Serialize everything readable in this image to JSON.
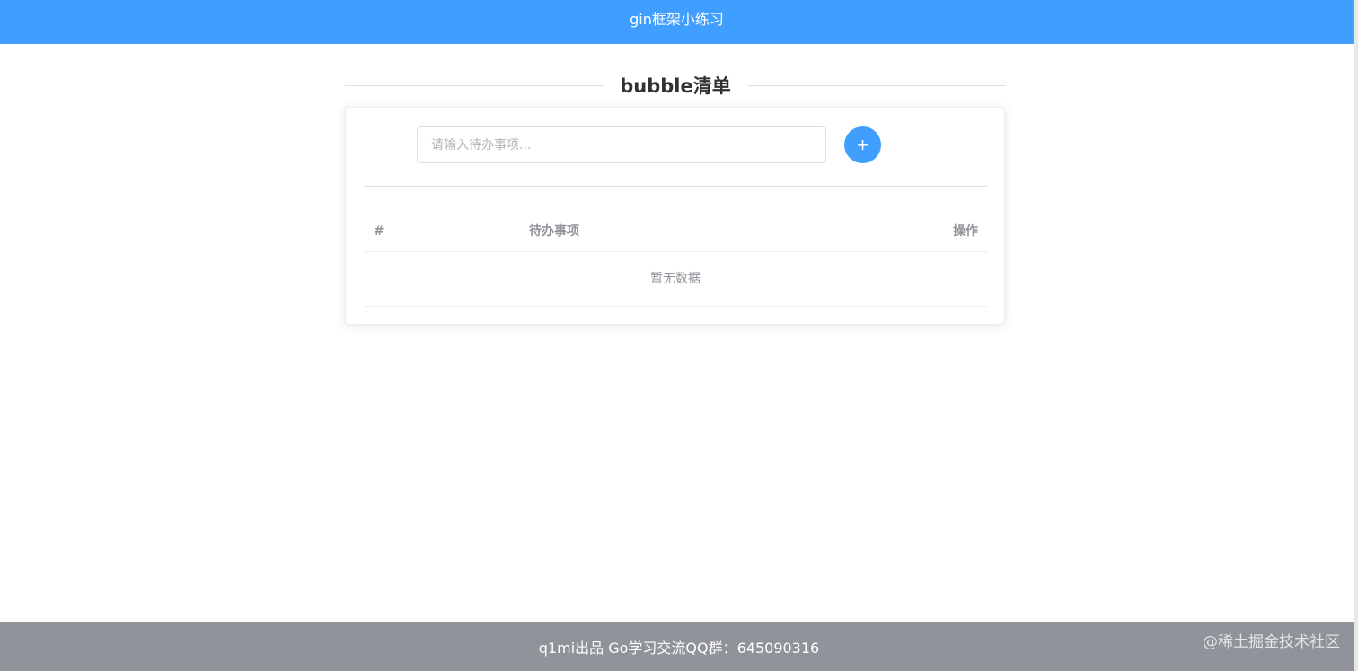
{
  "header": {
    "title": "gin框架小练习"
  },
  "main": {
    "title": "bubble清单",
    "input": {
      "placeholder": "请输入待办事项...",
      "value": ""
    },
    "add_button": {
      "icon": "plus-icon",
      "symbol": "+"
    },
    "table": {
      "columns": [
        "#",
        "待办事项",
        "操作"
      ],
      "rows": [],
      "empty_text": "暂无数据"
    }
  },
  "footer": {
    "text": "q1mi出品 Go学习交流QQ群：645090316",
    "watermark": "@稀土掘金技术社区"
  },
  "colors": {
    "primary": "#409eff",
    "footer_bg": "#909399"
  }
}
